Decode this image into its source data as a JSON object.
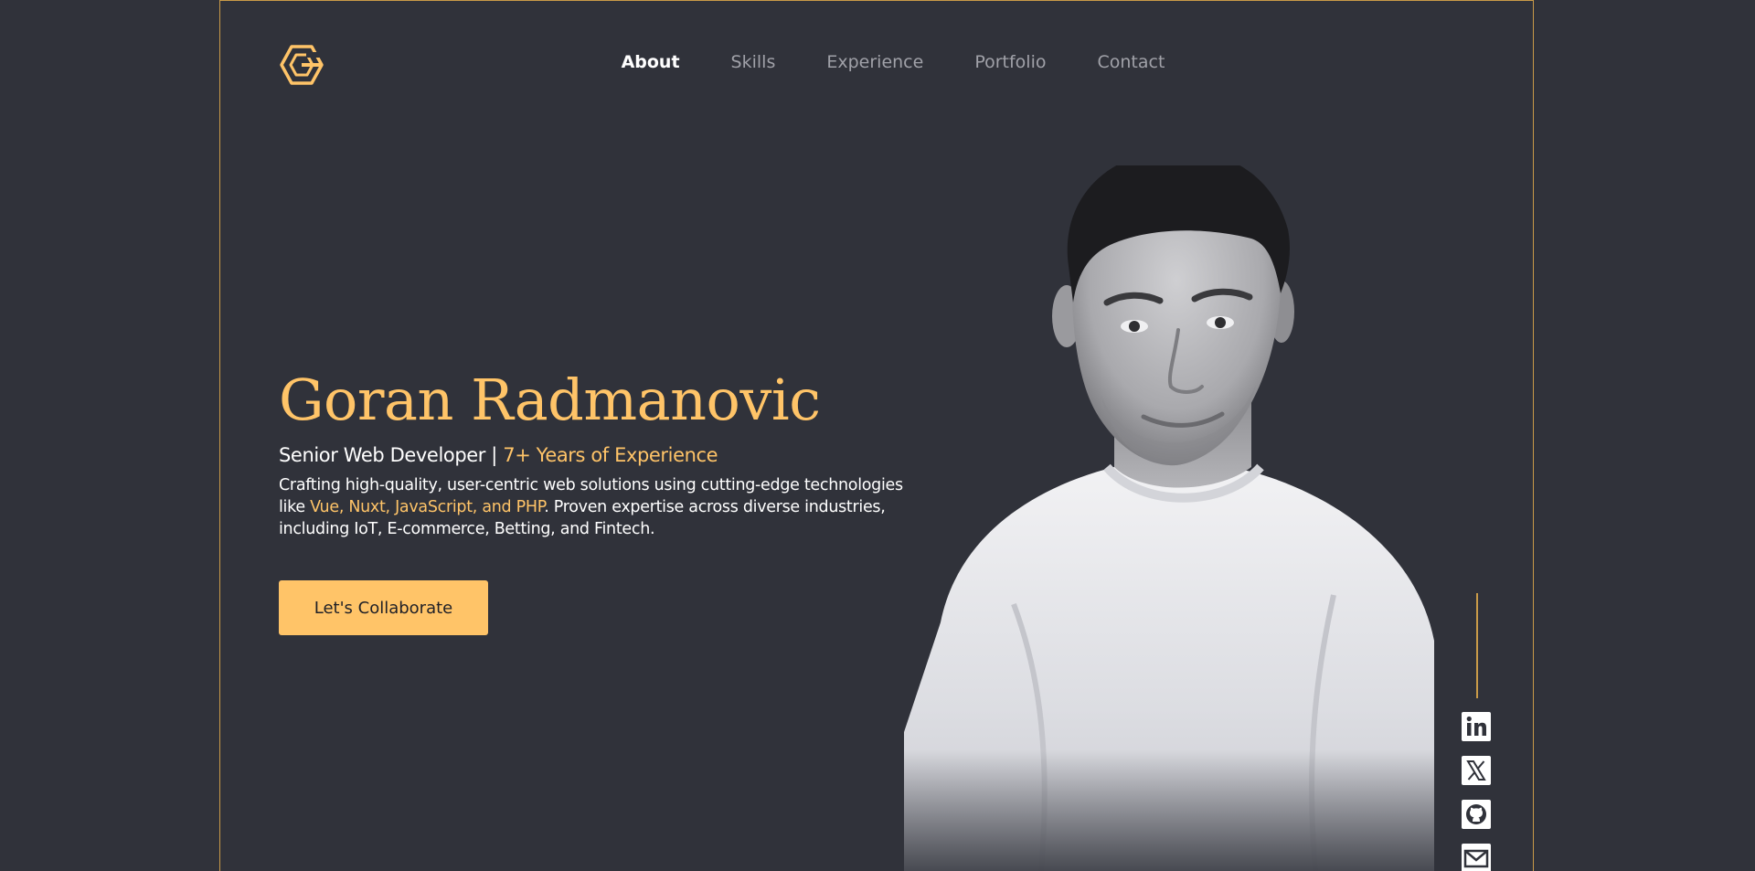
{
  "nav": {
    "items": [
      {
        "label": "About",
        "active": true
      },
      {
        "label": "Skills",
        "active": false
      },
      {
        "label": "Experience",
        "active": false
      },
      {
        "label": "Portfolio",
        "active": false
      },
      {
        "label": "Contact",
        "active": false
      }
    ]
  },
  "hero": {
    "name": "Goran Radmanovic",
    "subtitle_role": "Senior Web Developer | ",
    "subtitle_years": "7+ Years of Experience",
    "desc_part1": "Crafting high-quality, user-centric web solutions using cutting-edge technologies like ",
    "desc_tech": "Vue, Nuxt, JavaScript, and PHP",
    "desc_part2": ". Proven expertise across diverse industries, including IoT, E-commerce, Betting, and Fintech.",
    "cta_label": "Let's Collaborate"
  },
  "social": {
    "items": [
      "linkedin-icon",
      "x-twitter-icon",
      "github-icon",
      "email-icon"
    ]
  },
  "colors": {
    "background": "#30323a",
    "accent": "#ffc468",
    "frame_border": "#c99a48",
    "nav_inactive": "#a0a1a8"
  }
}
